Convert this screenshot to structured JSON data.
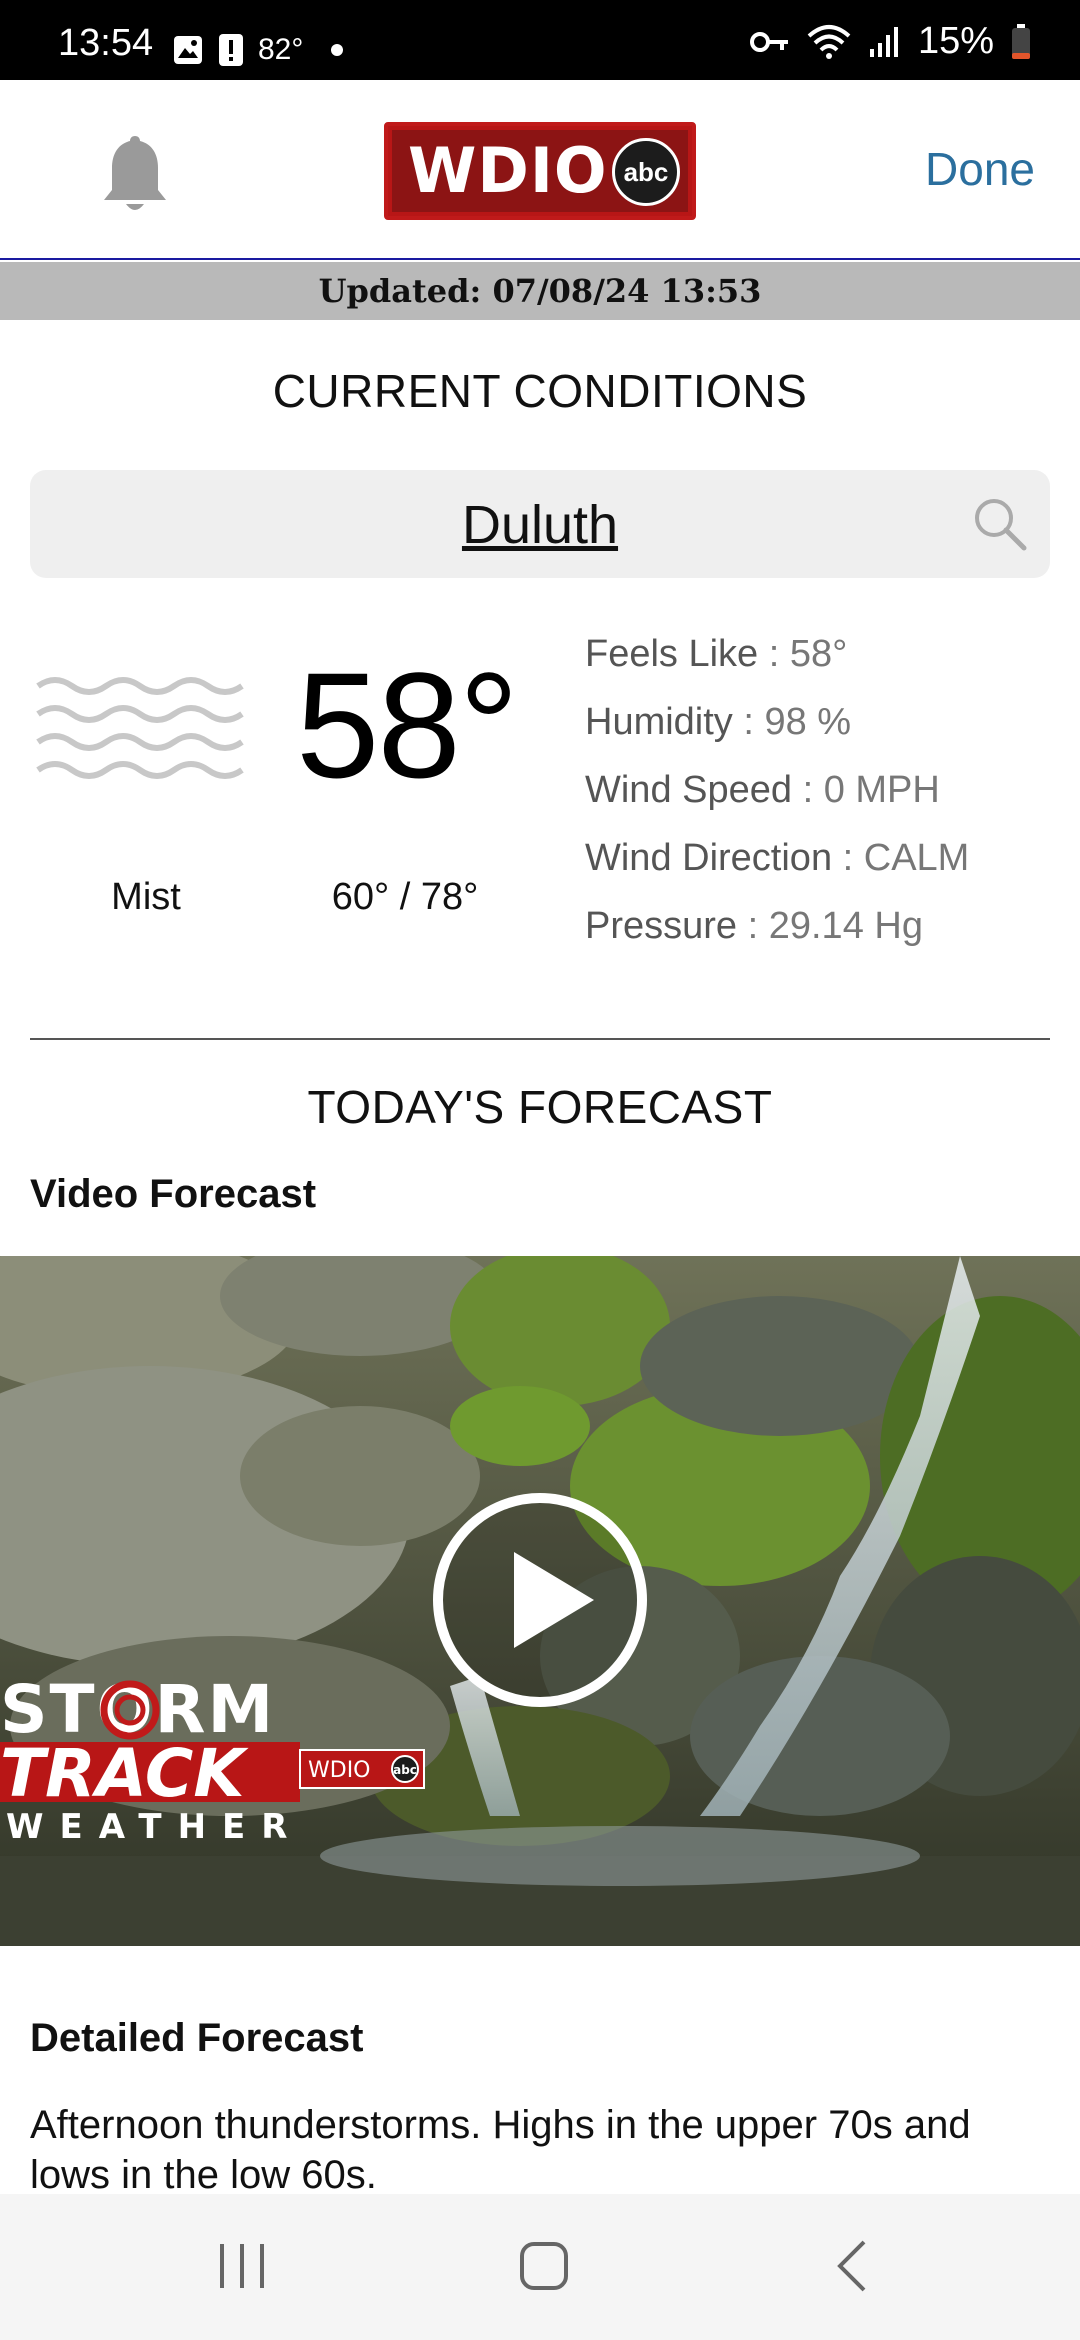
{
  "status_bar": {
    "time": "13:54",
    "temperature": "82°",
    "battery": "15%",
    "icons": [
      "gallery-icon",
      "alert-icon",
      "dot-icon",
      "vpn-key-icon",
      "wifi-icon",
      "signal-icon",
      "battery-icon"
    ]
  },
  "header": {
    "logo_text": "WDIO",
    "logo_badge": "abc",
    "done_label": "Done",
    "bell_icon": "bell-icon",
    "brand_color": "#b81616",
    "link_color": "#2b6f9e"
  },
  "updated": "Updated: 07/08/24 13:53",
  "current": {
    "title": "CURRENT CONDITIONS",
    "city": "Duluth",
    "temperature": "58°",
    "condition": "Mist",
    "hi_lo": "60° / 78°",
    "details": [
      {
        "label": "Feels Like",
        "value": " : 58°"
      },
      {
        "label": "Humidity",
        "value": " : 98 %"
      },
      {
        "label": "Wind Speed",
        "value": " : 0 MPH"
      },
      {
        "label": "Wind Direction",
        "value": " : CALM"
      },
      {
        "label": "Pressure",
        "value": " : 29.14 Hg"
      }
    ]
  },
  "forecast": {
    "title": "TODAY'S FORECAST",
    "video_heading": "Video Forecast",
    "video_logo": {
      "line1": "STORM",
      "line2": "TRACK",
      "line3": "WEATHER",
      "badge": "WDIO",
      "badge_abc": "abc"
    },
    "detailed_heading": "Detailed Forecast",
    "detailed_text": "Afternoon thunderstorms. Highs in the upper 70s and lows in the low 60s."
  },
  "nav": {
    "recents_icon": "recents-icon",
    "home_icon": "home-icon",
    "back_icon": "back-icon"
  }
}
